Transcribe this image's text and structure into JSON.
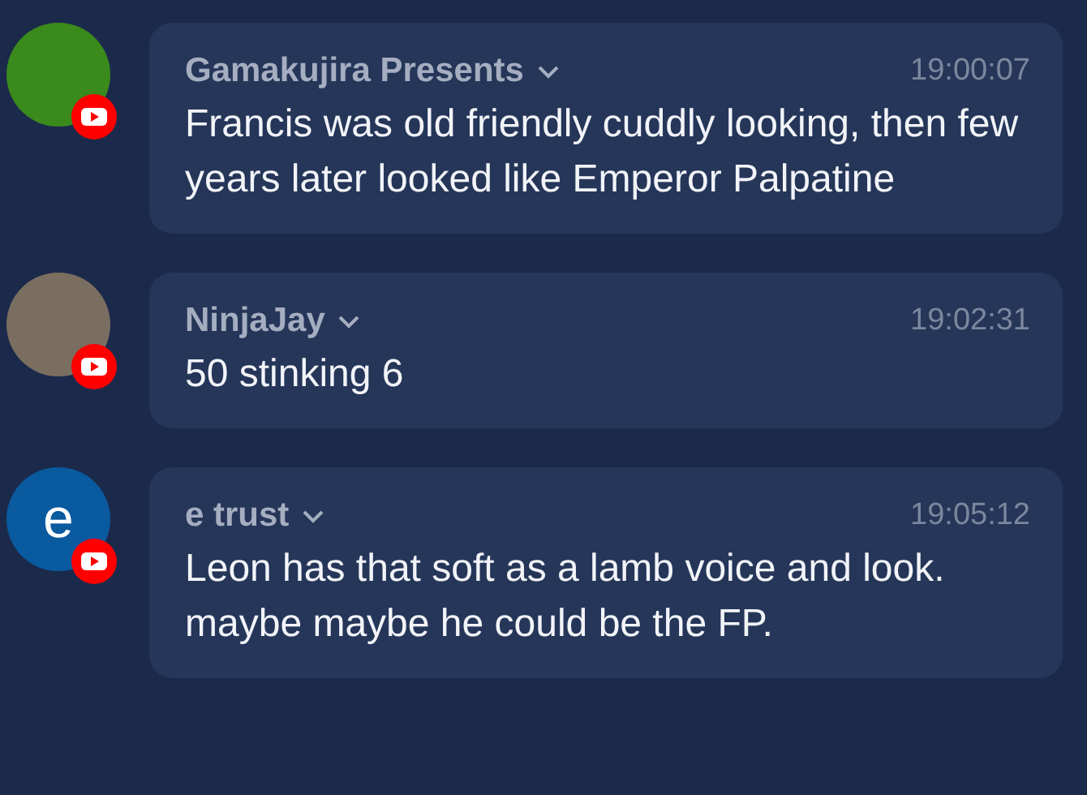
{
  "messages": [
    {
      "avatar": {
        "kind": "image",
        "color": "#3a8a1c"
      },
      "author": "Gamakujira Presents",
      "time": "19:00:07",
      "text": "Francis was old friendly cuddly looking, then few years later looked like Emperor Palpatine"
    },
    {
      "avatar": {
        "kind": "image",
        "color": "#7a6e60"
      },
      "author": "NinjaJay",
      "time": "19:02:31",
      "text": "50 stinking 6"
    },
    {
      "avatar": {
        "kind": "letter",
        "color": "#0a5aa0",
        "letter": "e"
      },
      "author": "e trust",
      "time": "19:05:12",
      "text": "Leon has that soft as a lamb voice and look. maybe maybe he could be the FP."
    }
  ]
}
